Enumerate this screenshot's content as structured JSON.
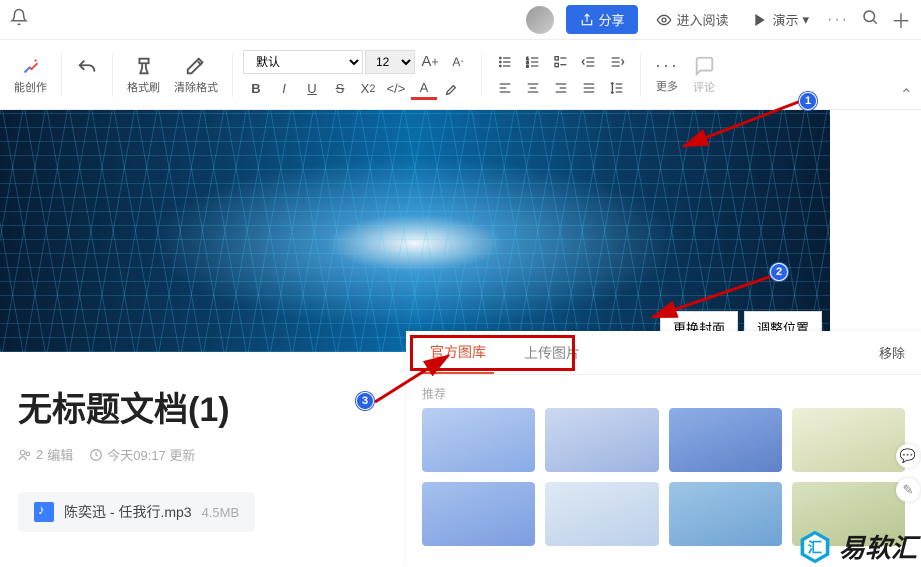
{
  "topbar": {
    "share_label": "分享",
    "read_label": "进入阅读",
    "present_label": "演示"
  },
  "toolbar": {
    "smart_label": "能创作",
    "format_painter_label": "格式刷",
    "clear_format_label": "清除格式",
    "font_name": "默认",
    "font_size": "12",
    "more_label": "更多",
    "comment_label": "评论"
  },
  "cover": {
    "change_label": "更换封面",
    "adjust_label": "调整位置"
  },
  "document": {
    "title": "无标题文档(1)",
    "editors_count": "2",
    "editors_label": "编辑",
    "updated_time": "今天09:17 更新"
  },
  "attachment": {
    "name": "陈奕迅 - 任我行.mp3",
    "size": "4.5MB"
  },
  "gallery": {
    "tab_official": "官方图库",
    "tab_upload": "上传图片",
    "remove_label": "移除",
    "section_label": "推荐",
    "thumbs": [
      "linear-gradient(160deg,#b9cef2,#8aabe6)",
      "linear-gradient(160deg,#cdd9f2,#9cb3e0)",
      "linear-gradient(160deg,#8daee6,#5e82c9)",
      "linear-gradient(160deg,#eef0d9,#cfd4a8)",
      "linear-gradient(160deg,#a6c1ee,#7d9de0)",
      "linear-gradient(160deg,#dfe9f5,#bcd0ea)",
      "linear-gradient(160deg,#9ec5e6,#6fa3d4)",
      "linear-gradient(160deg,#d9e2c0,#b8c590)"
    ]
  },
  "watermark": {
    "text": "易软汇"
  }
}
